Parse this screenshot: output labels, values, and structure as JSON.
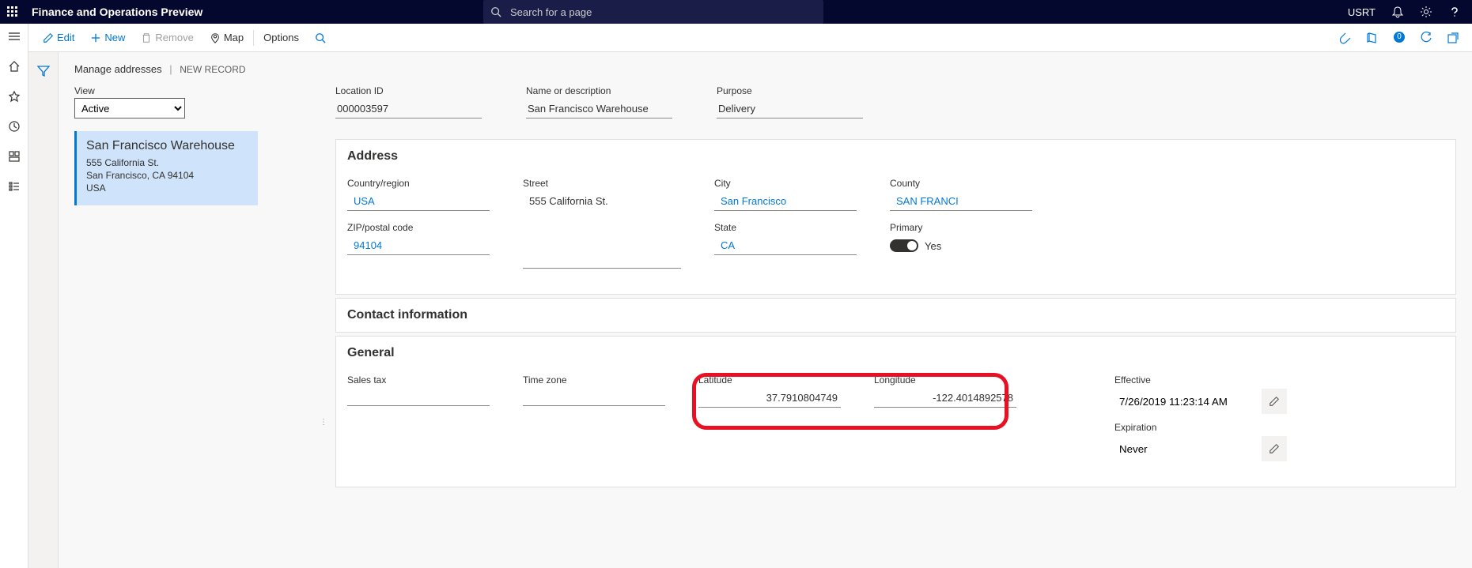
{
  "header": {
    "app_title": "Finance and Operations Preview",
    "search_placeholder": "Search for a page",
    "company": "USRT"
  },
  "actionbar": {
    "edit": "Edit",
    "new": "New",
    "remove": "Remove",
    "map": "Map",
    "options": "Options",
    "badge": "0"
  },
  "breadcrumb": {
    "page": "Manage addresses",
    "record": "NEW RECORD"
  },
  "listpane": {
    "view_label": "View",
    "view_value": "Active",
    "card": {
      "title": "San Francisco Warehouse",
      "line1": "555 California St.",
      "line2": "San Francisco, CA 94104",
      "line3": "USA"
    }
  },
  "detail": {
    "location_id": {
      "label": "Location ID",
      "value": "000003597"
    },
    "name": {
      "label": "Name or description",
      "value": "San Francisco Warehouse"
    },
    "purpose": {
      "label": "Purpose",
      "value": "Delivery"
    }
  },
  "address_section": {
    "title": "Address",
    "country": {
      "label": "Country/region",
      "value": "USA"
    },
    "zip": {
      "label": "ZIP/postal code",
      "value": "94104"
    },
    "street": {
      "label": "Street",
      "value": "555 California St."
    },
    "city": {
      "label": "City",
      "value": "San Francisco"
    },
    "state": {
      "label": "State",
      "value": "CA"
    },
    "county": {
      "label": "County",
      "value": "SAN FRANCI"
    },
    "primary": {
      "label": "Primary",
      "value": "Yes"
    }
  },
  "contact_section": {
    "title": "Contact information"
  },
  "general_section": {
    "title": "General",
    "sales_tax": {
      "label": "Sales tax",
      "value": ""
    },
    "time_zone": {
      "label": "Time zone",
      "value": ""
    },
    "latitude": {
      "label": "Latitude",
      "value": "37.7910804749"
    },
    "longitude": {
      "label": "Longitude",
      "value": "-122.4014892578"
    },
    "effective": {
      "label": "Effective",
      "value": "7/26/2019 11:23:14 AM"
    },
    "expiration": {
      "label": "Expiration",
      "value": "Never"
    }
  }
}
